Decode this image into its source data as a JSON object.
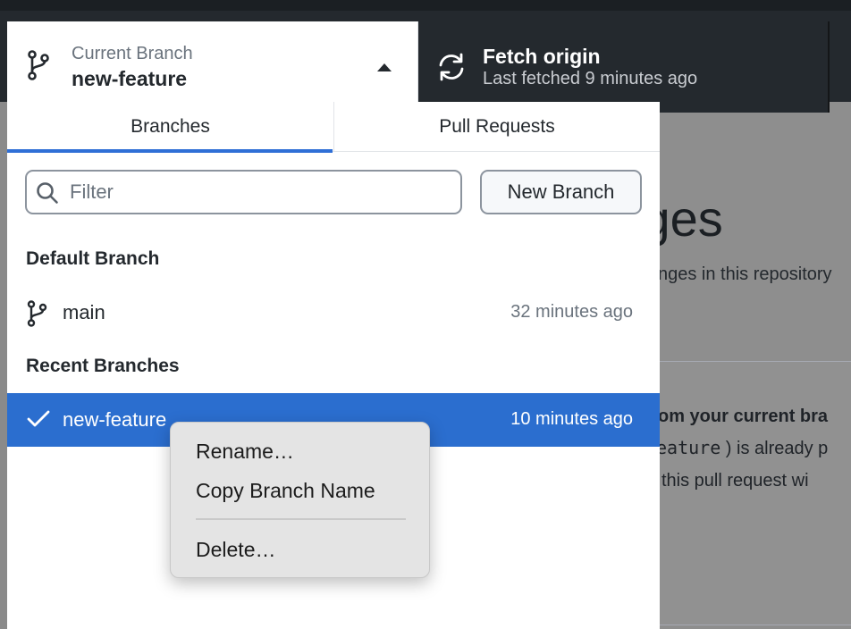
{
  "toolbar": {
    "branch": {
      "caption": "Current Branch",
      "value": "new-feature"
    },
    "fetch": {
      "caption": "Fetch origin",
      "sub": "Last fetched 9 minutes ago"
    }
  },
  "panel": {
    "tabs": [
      {
        "label": "Branches",
        "active": true
      },
      {
        "label": "Pull Requests",
        "active": false
      }
    ],
    "filter": {
      "placeholder": "Filter",
      "value": ""
    },
    "new_branch_label": "New Branch",
    "default_section": "Default Branch",
    "default_branches": [
      {
        "name": "main",
        "time": "32 minutes ago"
      }
    ],
    "recent_section": "Recent Branches",
    "recent_branches": [
      {
        "name": "new-feature",
        "time": "10 minutes ago",
        "selected": true
      }
    ]
  },
  "context_menu": {
    "items": [
      "Rename…",
      "Copy Branch Name",
      "Delete…"
    ]
  },
  "background": {
    "heading_fragment": "iges",
    "sub_fragment": "nges in this repository",
    "card_line1": "om your current bra",
    "card_line2_mono": "eature",
    "card_line2_rest": " ) is already p",
    "card_line3": "this pull request wi"
  },
  "colors": {
    "accent": "#2b6ecf",
    "toolbar": "#24292e",
    "tab_underline": "#2f6fd6"
  }
}
